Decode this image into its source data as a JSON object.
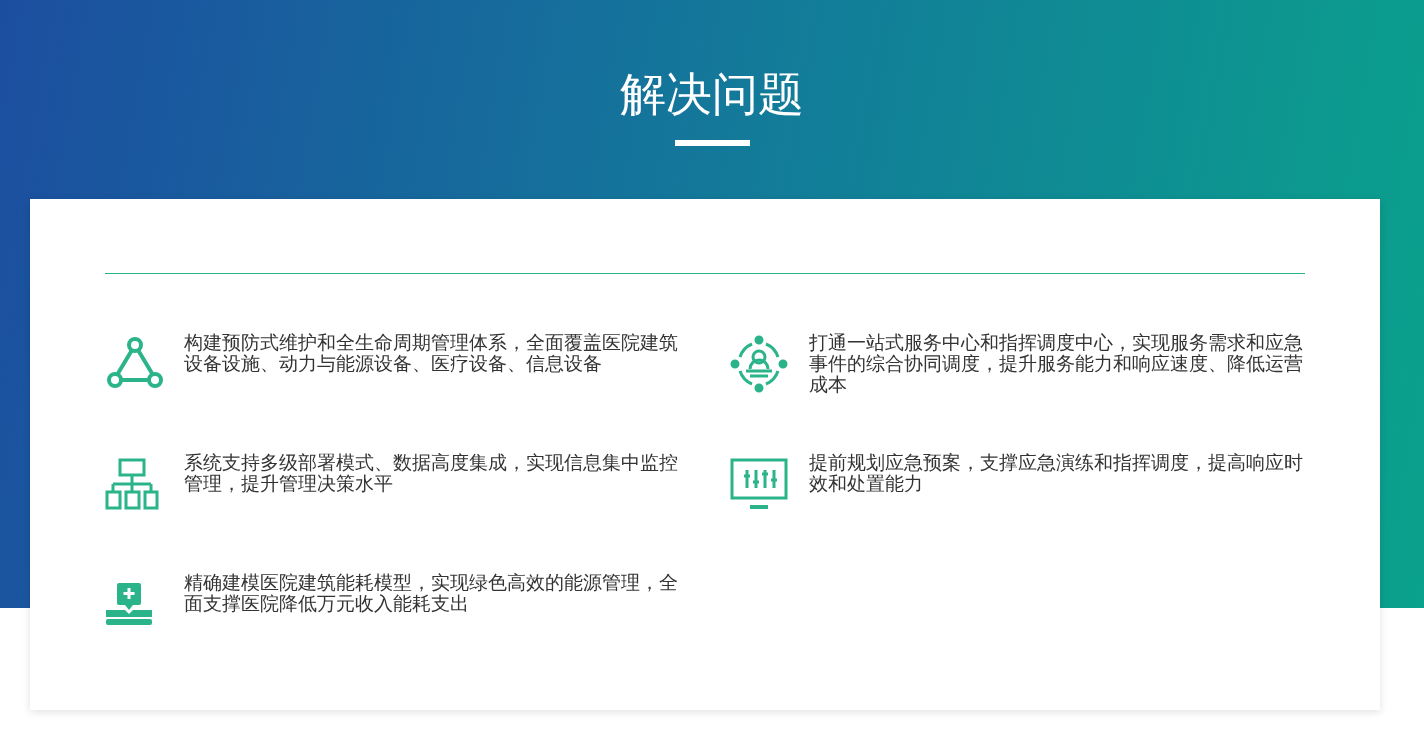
{
  "title": "解决问题",
  "items": [
    {
      "kind": "network",
      "text": "构建预防式维护和全生命周期管理体系，全面覆盖医院建筑设备设施、动力与能源设备、医疗设备、信息设备"
    },
    {
      "kind": "service",
      "text": "打通一站式服务中心和指挥调度中心，实现服务需求和应急事件的综合协同调度，提升服务能力和响应速度、降低运营成本"
    },
    {
      "kind": "hierarchy",
      "text": "系统支持多级部署模式、数据高度集成，实现信息集中监控管理，提升管理决策水平"
    },
    {
      "kind": "monitor",
      "text": "提前规划应急预案，支撑应急演练和指挥调度，提高响应时效和处置能力"
    },
    {
      "kind": "medical",
      "text": "精确建模医院建筑能耗模型，实现绿色高效的能源管理，全面支撑医院降低万元收入能耗支出"
    }
  ]
}
